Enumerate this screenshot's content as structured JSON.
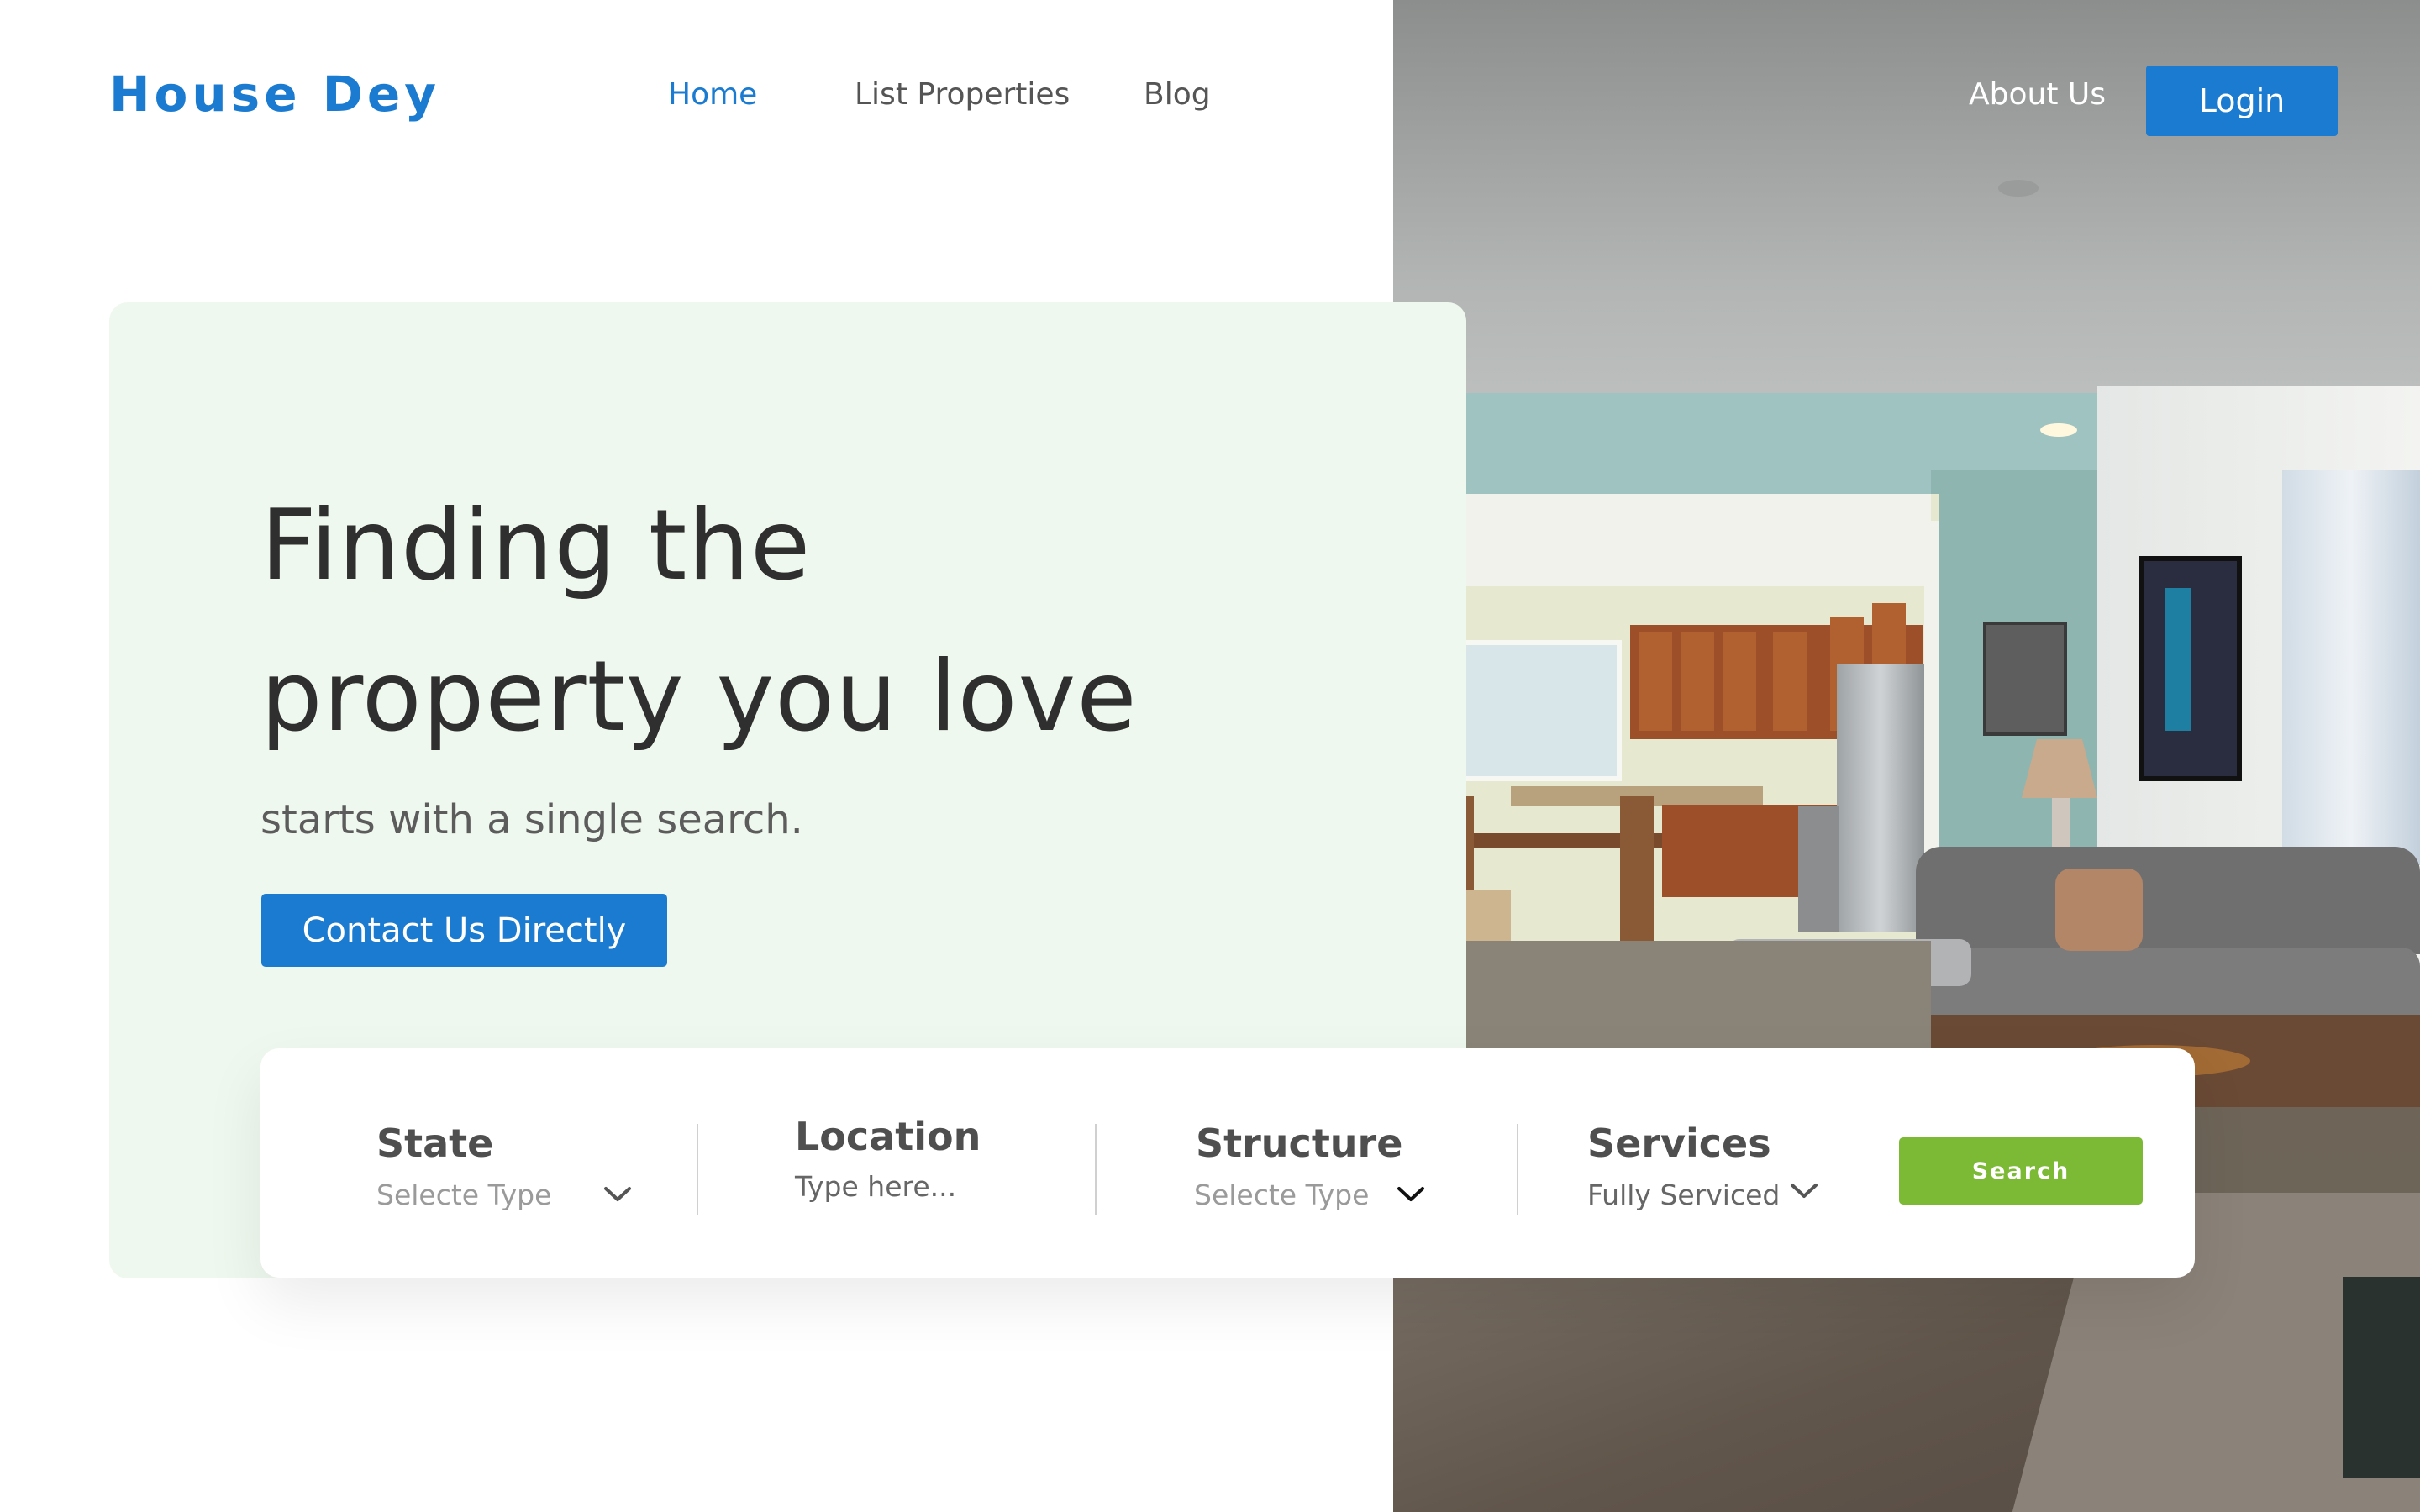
{
  "brand": {
    "name": "House Dey"
  },
  "nav": {
    "links": [
      "Home",
      "List Properties",
      "Blog"
    ],
    "about": "About Us",
    "login": "Login"
  },
  "hero": {
    "headline_line1": "Finding the",
    "headline_line2": "property you love",
    "subline": "starts with a single search.",
    "cta": "Contact Us Directly"
  },
  "search": {
    "fields": [
      {
        "label": "State",
        "value": "Selecte Type"
      },
      {
        "label": "Location",
        "value": "Type here..."
      },
      {
        "label": "Structure",
        "value": "Selecte Type"
      },
      {
        "label": "Services",
        "value": "Fully Serviced"
      }
    ],
    "button": "Search"
  },
  "colors": {
    "brand_blue": "#1a7bd0",
    "hero_bg": "#eff8ee",
    "search_green": "#7cba36",
    "text_dark": "#2f2f2f"
  },
  "icons": {
    "chevron": "chevron-down-icon"
  }
}
